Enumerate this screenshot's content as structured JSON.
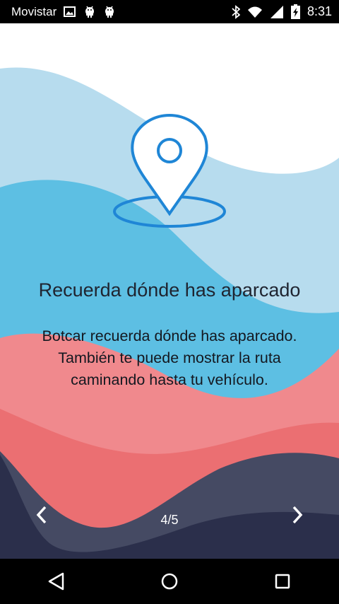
{
  "status_bar": {
    "carrier": "Movistar",
    "time": "8:31",
    "left_icons": [
      "image-icon",
      "android-icon",
      "android-icon"
    ],
    "right_icons": [
      "bluetooth-icon",
      "wifi-icon",
      "signal-icon",
      "battery-charging-icon"
    ]
  },
  "slide": {
    "title": "Recuerda dónde has aparcado",
    "description": "Botcar recuerda dónde has aparcado. También te puede mostrar la ruta caminando hasta tu vehículo.",
    "pager": "4/5",
    "icon": "location-pin-icon"
  },
  "colors": {
    "wave_light_blue": "#b7dcee",
    "wave_blue": "#5dbfe3",
    "wave_pink": "#f0898d",
    "wave_red": "#eb6f72",
    "wave_slate": "#454a63",
    "wave_navy": "#2b2f4b",
    "icon_blue": "#1f86d6"
  },
  "nav_bar": {
    "buttons": [
      "back-icon",
      "home-icon",
      "recents-icon"
    ]
  }
}
